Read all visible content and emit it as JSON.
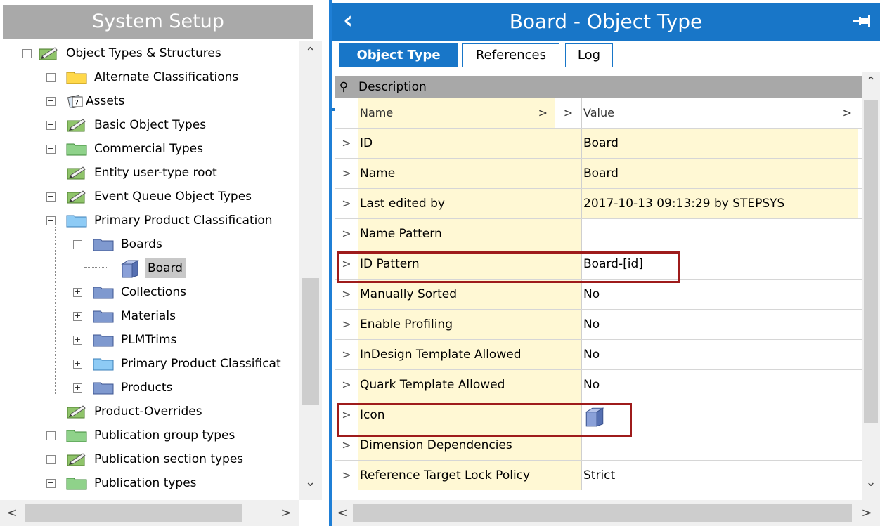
{
  "left": {
    "title": "System Setup",
    "tree": [
      {
        "label": "Object Types & Structures",
        "icon": "object-type-icon",
        "expander": "−"
      },
      {
        "label": "Alternate Classifications",
        "icon": "yellow-folder-icon",
        "expander": "+"
      },
      {
        "label": "Assets",
        "icon": "asset-icon",
        "expander": "+"
      },
      {
        "label": "Basic Object Types",
        "icon": "object-type-icon",
        "expander": "+"
      },
      {
        "label": "Commercial Types",
        "icon": "green-folder-icon",
        "expander": "+"
      },
      {
        "label": "Entity user-type root",
        "icon": "object-type-icon",
        "expander": ""
      },
      {
        "label": "Event Queue Object Types",
        "icon": "object-type-icon",
        "expander": "+"
      },
      {
        "label": "Primary Product Classification",
        "icon": "light-blue-folder-icon",
        "expander": "−"
      },
      {
        "label": "Boards",
        "icon": "dark-blue-folder-icon",
        "expander": "−"
      },
      {
        "label": "Board",
        "icon": "cube-icon",
        "expander": ""
      },
      {
        "label": "Collections",
        "icon": "dark-blue-folder-icon",
        "expander": "+"
      },
      {
        "label": "Materials",
        "icon": "dark-blue-folder-icon",
        "expander": "+"
      },
      {
        "label": "PLMTrims",
        "icon": "dark-blue-folder-icon",
        "expander": "+"
      },
      {
        "label": "Primary Product Classificat",
        "icon": "light-blue-folder-icon",
        "expander": "+"
      },
      {
        "label": "Products",
        "icon": "dark-blue-folder-icon",
        "expander": "+"
      },
      {
        "label": "Product-Overrides",
        "icon": "object-type-icon",
        "expander": ""
      },
      {
        "label": "Publication group types",
        "icon": "green-folder-icon",
        "expander": "+"
      },
      {
        "label": "Publication section types",
        "icon": "object-type-icon",
        "expander": "+"
      },
      {
        "label": "Publication types",
        "icon": "green-folder-icon",
        "expander": "+"
      }
    ]
  },
  "right": {
    "title": "Board - Object Type",
    "tabs": [
      {
        "label": "Object Type",
        "active": true
      },
      {
        "label": "References",
        "active": false
      },
      {
        "label": "Log",
        "active": false
      }
    ],
    "section": "Description",
    "columns": {
      "name": "Name",
      "value": "Value"
    },
    "rows": [
      {
        "name": "ID",
        "value": "Board",
        "filled": true
      },
      {
        "name": "Name",
        "value": "Board",
        "filled": true
      },
      {
        "name": "Last edited by",
        "value": "2017-10-13 09:13:29 by STEPSYS",
        "filled": true
      },
      {
        "name": "Name Pattern",
        "value": "",
        "filled": false
      },
      {
        "name": "ID Pattern",
        "value": "Board-[id]",
        "filled": false
      },
      {
        "name": "Manually Sorted",
        "value": "No",
        "filled": false
      },
      {
        "name": "Enable Profiling",
        "value": "No",
        "filled": false
      },
      {
        "name": "InDesign Template Allowed",
        "value": "No",
        "filled": false
      },
      {
        "name": "Quark Template Allowed",
        "value": "No",
        "filled": false
      },
      {
        "name": "Icon",
        "value": "",
        "icon": "cube-icon",
        "filled": false
      },
      {
        "name": "Dimension Dependencies",
        "value": "",
        "filled": false
      },
      {
        "name": "Reference Target Lock Policy",
        "value": "Strict",
        "filled": false
      }
    ]
  },
  "colors": {
    "accent": "#1876c8",
    "highlight": "#9e1b1b",
    "cell_bg": "#fff8d4"
  }
}
